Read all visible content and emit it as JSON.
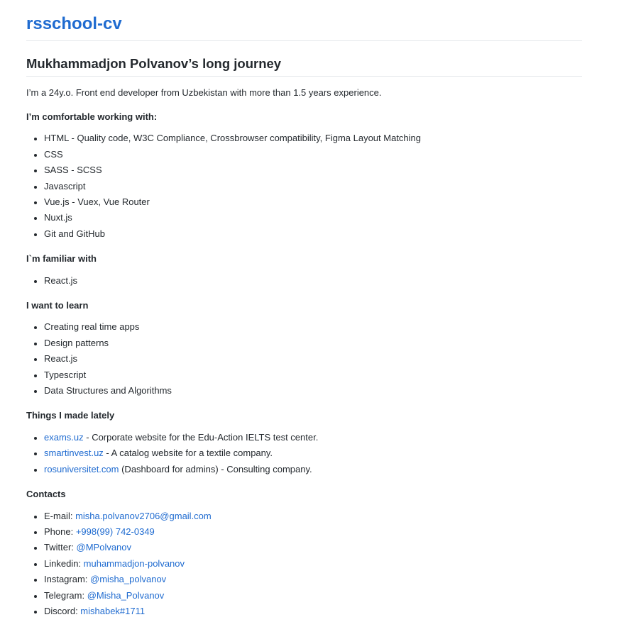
{
  "site_title": "rsschool-cv",
  "heading": "Mukhammadjon Polvanov’s long journey",
  "intro": "I’m a 24y.o. Front end developer from Uzbekistan with more than 1.5 years experience.",
  "comfortable": {
    "title": "I’m comfortable working with:",
    "items": [
      "HTML - Quality code, W3C Compliance, Crossbrowser compatibility, Figma Layout Matching",
      "CSS",
      "SASS - SCSS",
      "Javascript",
      "Vue.js - Vuex, Vue Router",
      "Nuxt.js",
      "Git and GitHub"
    ]
  },
  "familiar": {
    "title": "I`m familiar with",
    "items": [
      "React.js"
    ]
  },
  "learn": {
    "title": "I want to learn",
    "items": [
      "Creating real time apps",
      "Design patterns",
      "React.js",
      "Typescript",
      "Data Structures and Algorithms"
    ]
  },
  "projects": {
    "title": "Things I made lately",
    "items": [
      {
        "link": "exams.uz",
        "text": " - Corporate website for the Edu-Action IELTS test center."
      },
      {
        "link": "smartinvest.uz",
        "text": " - A catalog website for a textile company."
      },
      {
        "link": "rosuniversitet.com",
        "text": " (Dashboard for admins) - Consulting company."
      }
    ]
  },
  "contacts": {
    "title": "Contacts",
    "items": [
      {
        "label": "E-mail: ",
        "link": "misha.polvanov2706@gmail.com"
      },
      {
        "label": "Phone: ",
        "link": "+998(99) 742-0349"
      },
      {
        "label": "Twitter: ",
        "link": "@MPolvanov"
      },
      {
        "label": "Linkedin: ",
        "link": "muhammadjon-polvanov"
      },
      {
        "label": "Instagram: ",
        "link": "@misha_polvanov"
      },
      {
        "label": "Telegram: ",
        "link": "@Misha_Polvanov"
      },
      {
        "label": "Discord: ",
        "link": "mishabek#1711"
      }
    ]
  },
  "colors": {
    "link": "#1f6bd0",
    "text": "#24292e",
    "divider": "#e4e7eb"
  }
}
